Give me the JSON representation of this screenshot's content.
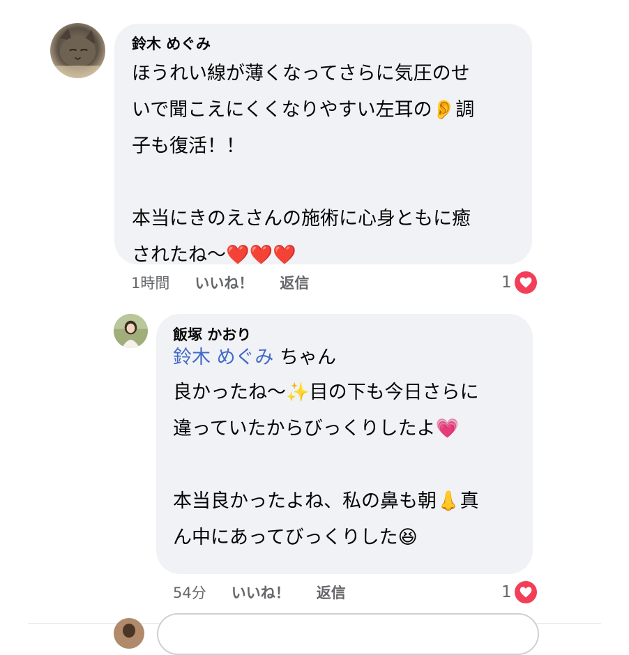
{
  "comments": [
    {
      "author": "鈴木 めぐみ",
      "lines": [
        "ほうれい線が薄くなってさらに気圧のせ",
        "いで聞こえにくくなりやすい左耳の👂調",
        "子も復活！！",
        "",
        "本当にきのえさんの施術に心身ともに癒",
        "されたね〜❤️❤️❤️"
      ],
      "time": "1時間",
      "like_label": "いいね！",
      "reply_label": "返信",
      "reaction_count": "1"
    },
    {
      "author": "飯塚 かおり",
      "mention": "鈴木 めぐみ",
      "mention_suffix": " ちゃん",
      "lines": [
        "良かったね〜✨目の下も今日さらに",
        "違っていたからびっくりしたよ💗",
        "",
        "本当良かったよね、私の鼻も朝👃真",
        "ん中にあってびっくりした😆"
      ],
      "time": "54分",
      "like_label": "いいね！",
      "reply_label": "返信",
      "reaction_count": "1"
    }
  ],
  "colors": {
    "bubble": "#f0f2f5",
    "mention": "#4169c8",
    "heart": "#f33e58",
    "meta_text": "#65676b"
  },
  "icons": {
    "reaction": "heart-icon",
    "avatar_1": "cat-avatar",
    "avatar_2": "woman-avatar"
  }
}
